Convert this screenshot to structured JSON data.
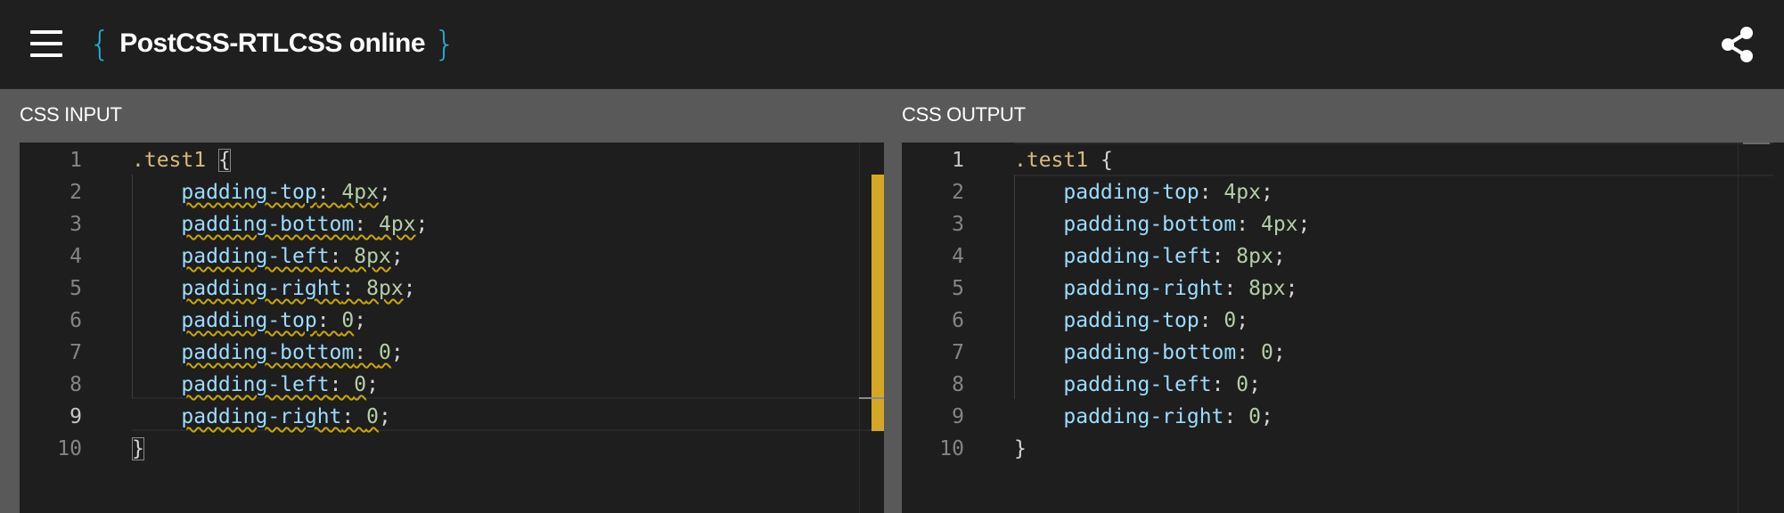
{
  "header": {
    "brace_open": "{",
    "title": "PostCSS-RTLCSS online",
    "brace_close": "}",
    "menu_icon": "hamburger-menu-icon",
    "share_icon": "share-icon"
  },
  "input_panel": {
    "label": "CSS INPUT",
    "active_line": 9,
    "lines": [
      {
        "n": "1",
        "tokens": [
          {
            "t": ".test1",
            "c": "sel"
          },
          {
            "t": " "
          },
          {
            "t": "{",
            "c": "punc bracket"
          }
        ]
      },
      {
        "n": "2",
        "tokens": [
          {
            "t": "    "
          },
          {
            "t": "padding-top",
            "c": "prop squig"
          },
          {
            "t": ": ",
            "c": "punc squig"
          },
          {
            "t": "4px",
            "c": "num squig"
          },
          {
            "t": ";",
            "c": "punc"
          }
        ]
      },
      {
        "n": "3",
        "tokens": [
          {
            "t": "    "
          },
          {
            "t": "padding-bottom",
            "c": "prop squig"
          },
          {
            "t": ": ",
            "c": "punc squig"
          },
          {
            "t": "4px",
            "c": "num squig"
          },
          {
            "t": ";",
            "c": "punc"
          }
        ]
      },
      {
        "n": "4",
        "tokens": [
          {
            "t": "    "
          },
          {
            "t": "padding-left",
            "c": "prop squig"
          },
          {
            "t": ": ",
            "c": "punc squig"
          },
          {
            "t": "8px",
            "c": "num squig"
          },
          {
            "t": ";",
            "c": "punc"
          }
        ]
      },
      {
        "n": "5",
        "tokens": [
          {
            "t": "    "
          },
          {
            "t": "padding-right",
            "c": "prop squig"
          },
          {
            "t": ": ",
            "c": "punc squig"
          },
          {
            "t": "8px",
            "c": "num squig"
          },
          {
            "t": ";",
            "c": "punc"
          }
        ]
      },
      {
        "n": "6",
        "tokens": [
          {
            "t": "    "
          },
          {
            "t": "padding-top",
            "c": "prop squig"
          },
          {
            "t": ": ",
            "c": "punc squig"
          },
          {
            "t": "0",
            "c": "num squig"
          },
          {
            "t": ";",
            "c": "punc"
          }
        ]
      },
      {
        "n": "7",
        "tokens": [
          {
            "t": "    "
          },
          {
            "t": "padding-bottom",
            "c": "prop squig"
          },
          {
            "t": ": ",
            "c": "punc squig"
          },
          {
            "t": "0",
            "c": "num squig"
          },
          {
            "t": ";",
            "c": "punc"
          }
        ]
      },
      {
        "n": "8",
        "tokens": [
          {
            "t": "    "
          },
          {
            "t": "padding-left",
            "c": "prop squig"
          },
          {
            "t": ": ",
            "c": "punc squig"
          },
          {
            "t": "0",
            "c": "num squig"
          },
          {
            "t": ";",
            "c": "punc"
          }
        ]
      },
      {
        "n": "9",
        "tokens": [
          {
            "t": "    "
          },
          {
            "t": "padding-right",
            "c": "prop squig"
          },
          {
            "t": ": ",
            "c": "punc squig"
          },
          {
            "t": "0",
            "c": "num squig"
          },
          {
            "t": ";",
            "c": "punc"
          }
        ]
      },
      {
        "n": "10",
        "tokens": [
          {
            "t": "}",
            "c": "punc bracket"
          }
        ]
      }
    ]
  },
  "output_panel": {
    "label": "CSS OUTPUT",
    "active_line": 1,
    "lines": [
      {
        "n": "1",
        "tokens": [
          {
            "t": ".test1",
            "c": "sel"
          },
          {
            "t": " "
          },
          {
            "t": "{",
            "c": "punc"
          }
        ]
      },
      {
        "n": "2",
        "tokens": [
          {
            "t": "    "
          },
          {
            "t": "padding-top",
            "c": "prop"
          },
          {
            "t": ": ",
            "c": "punc"
          },
          {
            "t": "4px",
            "c": "num"
          },
          {
            "t": ";",
            "c": "punc"
          }
        ]
      },
      {
        "n": "3",
        "tokens": [
          {
            "t": "    "
          },
          {
            "t": "padding-bottom",
            "c": "prop"
          },
          {
            "t": ": ",
            "c": "punc"
          },
          {
            "t": "4px",
            "c": "num"
          },
          {
            "t": ";",
            "c": "punc"
          }
        ]
      },
      {
        "n": "4",
        "tokens": [
          {
            "t": "    "
          },
          {
            "t": "padding-left",
            "c": "prop"
          },
          {
            "t": ": ",
            "c": "punc"
          },
          {
            "t": "8px",
            "c": "num"
          },
          {
            "t": ";",
            "c": "punc"
          }
        ]
      },
      {
        "n": "5",
        "tokens": [
          {
            "t": "    "
          },
          {
            "t": "padding-right",
            "c": "prop"
          },
          {
            "t": ": ",
            "c": "punc"
          },
          {
            "t": "8px",
            "c": "num"
          },
          {
            "t": ";",
            "c": "punc"
          }
        ]
      },
      {
        "n": "6",
        "tokens": [
          {
            "t": "    "
          },
          {
            "t": "padding-top",
            "c": "prop"
          },
          {
            "t": ": ",
            "c": "punc"
          },
          {
            "t": "0",
            "c": "num"
          },
          {
            "t": ";",
            "c": "punc"
          }
        ]
      },
      {
        "n": "7",
        "tokens": [
          {
            "t": "    "
          },
          {
            "t": "padding-bottom",
            "c": "prop"
          },
          {
            "t": ": ",
            "c": "punc"
          },
          {
            "t": "0",
            "c": "num"
          },
          {
            "t": ";",
            "c": "punc"
          }
        ]
      },
      {
        "n": "8",
        "tokens": [
          {
            "t": "    "
          },
          {
            "t": "padding-left",
            "c": "prop"
          },
          {
            "t": ": ",
            "c": "punc"
          },
          {
            "t": "0",
            "c": "num"
          },
          {
            "t": ";",
            "c": "punc"
          }
        ]
      },
      {
        "n": "9",
        "tokens": [
          {
            "t": "    "
          },
          {
            "t": "padding-right",
            "c": "prop"
          },
          {
            "t": ": ",
            "c": "punc"
          },
          {
            "t": "0",
            "c": "num"
          },
          {
            "t": ";",
            "c": "punc"
          }
        ]
      },
      {
        "n": "10",
        "tokens": [
          {
            "t": "}",
            "c": "punc"
          }
        ]
      }
    ]
  },
  "colors": {
    "header_bg": "#1f1f1f",
    "panel_bg": "#595959",
    "editor_bg": "#1e1e1e",
    "brand_accent": "#26b0d9",
    "selector": "#d7ba7d",
    "property": "#9cdcfe",
    "number": "#b5cea8",
    "warning": "#cca700"
  }
}
